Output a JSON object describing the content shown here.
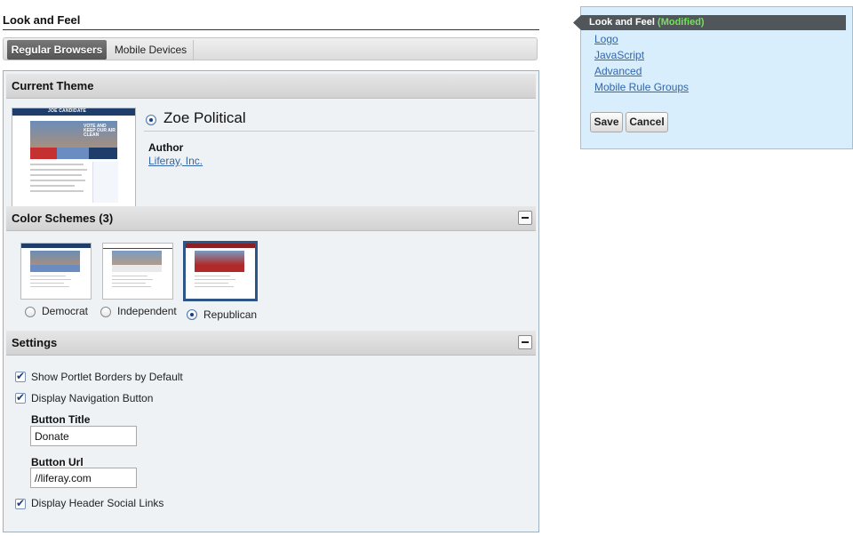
{
  "page": {
    "title": "Look and Feel"
  },
  "tabs": [
    {
      "label": "Regular Browsers",
      "active": true
    },
    {
      "label": "Mobile Devices",
      "active": false
    }
  ],
  "current_theme": {
    "heading": "Current Theme",
    "name": "Zoe Political",
    "author_label": "Author",
    "author_name": "Liferay, Inc.",
    "thumbnail": {
      "title": "JOE CANDIDATE",
      "hero_text": "VOTE AND KEEP OUR AIR CLEAN"
    }
  },
  "color_schemes": {
    "heading": "Color Schemes (3)",
    "items": [
      {
        "label": "Democrat",
        "selected": false,
        "accent": "#1f3d6b"
      },
      {
        "label": "Independent",
        "selected": false,
        "accent": "#a0202a"
      },
      {
        "label": "Republican",
        "selected": true,
        "accent": "#b02a2a"
      }
    ]
  },
  "settings": {
    "heading": "Settings",
    "show_portlet_borders": {
      "label": "Show Portlet Borders by Default",
      "checked": true
    },
    "display_nav_button": {
      "label": "Display Navigation Button",
      "checked": true
    },
    "button_title": {
      "label": "Button Title",
      "value": "Donate"
    },
    "button_url": {
      "label": "Button Url",
      "value": "//liferay.com"
    },
    "display_header_social": {
      "label": "Display Header Social Links",
      "checked": true
    }
  },
  "sidebar": {
    "current": {
      "label": "Look and Feel",
      "badge": "(Modified)"
    },
    "links": [
      "Logo",
      "JavaScript",
      "Advanced",
      "Mobile Rule Groups"
    ],
    "save_label": "Save",
    "cancel_label": "Cancel"
  },
  "colors": {
    "accent_blue": "#1d3e7a",
    "link": "#3366aa",
    "sidebar_bg": "#d9eefd",
    "modified": "#77e060"
  }
}
